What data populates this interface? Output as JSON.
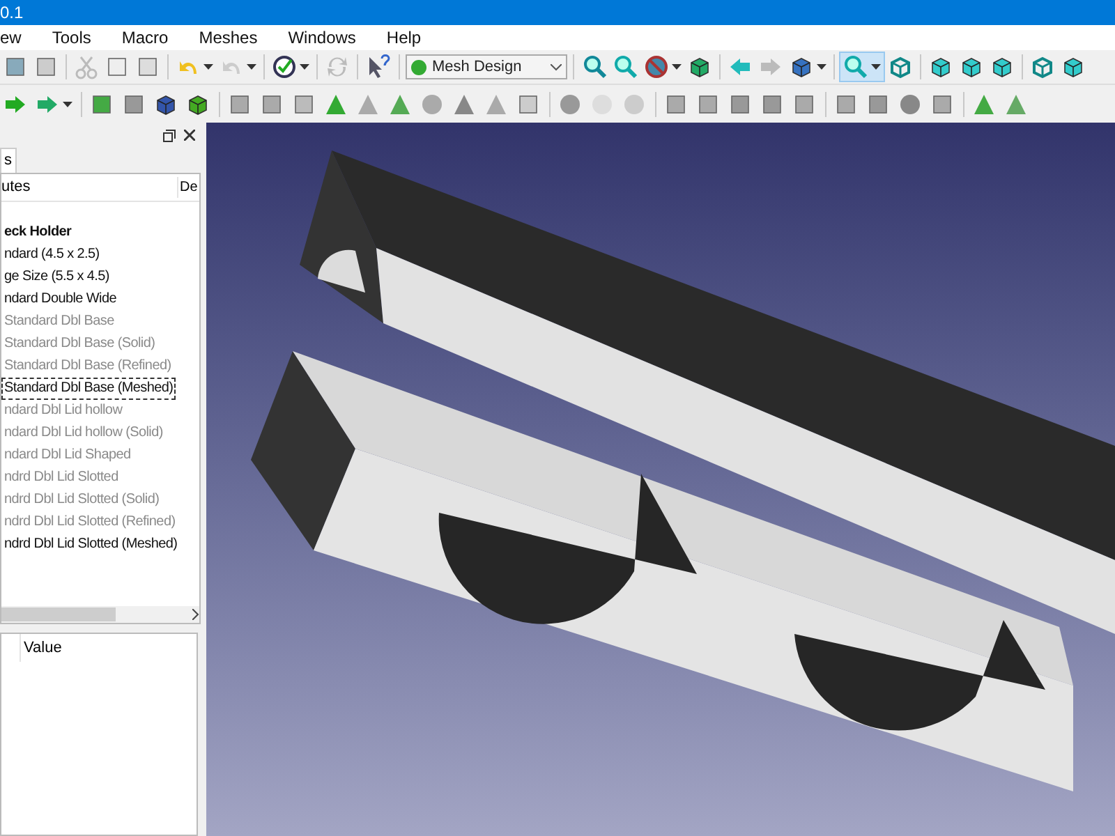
{
  "window": {
    "title": "0.1"
  },
  "menu": [
    "ew",
    "Tools",
    "Macro",
    "Meshes",
    "Windows",
    "Help"
  ],
  "workbench": {
    "value": "Mesh Design"
  },
  "panel": {
    "tab": "s",
    "tree_columns": [
      "utes",
      "De"
    ],
    "tree": [
      {
        "label": "eck Holder",
        "active": true,
        "visible": true,
        "selected": false,
        "children": [
          {
            "label": "ndard (4.5 x 2.5)",
            "active": false,
            "visible": true,
            "selected": false
          },
          {
            "label": "ge Size (5.5 x 4.5)",
            "active": false,
            "visible": true,
            "selected": false
          },
          {
            "label": "ndard Double Wide",
            "active": false,
            "visible": true,
            "selected": false
          },
          {
            "label": "Standard Dbl Base",
            "active": false,
            "visible": false,
            "selected": false
          },
          {
            "label": "Standard Dbl Base (Solid)",
            "active": false,
            "visible": false,
            "selected": false
          },
          {
            "label": "Standard Dbl Base (Refined)",
            "active": false,
            "visible": false,
            "selected": false
          },
          {
            "label": "Standard Dbl Base (Meshed)",
            "active": false,
            "visible": true,
            "selected": true
          },
          {
            "label": "ndard Dbl Lid hollow",
            "active": false,
            "visible": false,
            "selected": false
          },
          {
            "label": "ndard Dbl Lid hollow (Solid)",
            "active": false,
            "visible": false,
            "selected": false
          },
          {
            "label": "ndard Dbl Lid Shaped",
            "active": false,
            "visible": false,
            "selected": false
          },
          {
            "label": "ndrd Dbl Lid Slotted",
            "active": false,
            "visible": false,
            "selected": false
          },
          {
            "label": "ndrd Dbl Lid Slotted (Solid)",
            "active": false,
            "visible": false,
            "selected": false
          },
          {
            "label": "ndrd Dbl Lid Slotted (Refined)",
            "active": false,
            "visible": false,
            "selected": false
          },
          {
            "label": "ndrd Dbl Lid Slotted (Meshed)",
            "active": false,
            "visible": true,
            "selected": false
          }
        ]
      }
    ],
    "property_columns": [
      "Value"
    ]
  }
}
